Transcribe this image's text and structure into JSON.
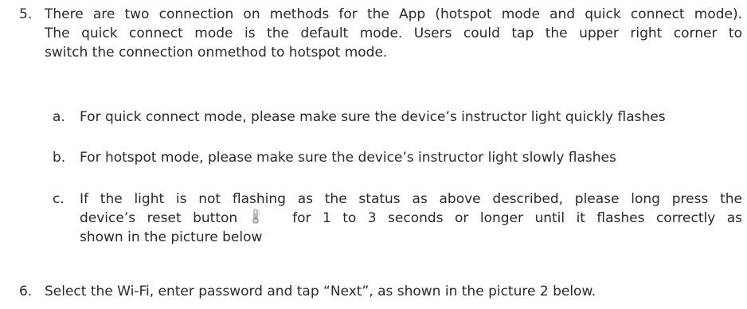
{
  "items": [
    {
      "number": "5.",
      "lines": [
        "There are two connection on methods for the App (hotspot mode and quick connect mode).",
        "The quick connect mode is the default mode. Users could tap the upper right corner to",
        "switch the connection onmethod to hotspot mode."
      ]
    },
    {
      "number": "a.",
      "lines": [
        "For quick connect mode, please make sure the device’s instructor light quickly flashes"
      ]
    },
    {
      "number": "b.",
      "lines": [
        "For hotspot mode, please make sure the device’s instructor light slowly flashes"
      ]
    },
    {
      "number": "c.",
      "line1": "If the light is not flashing as the status as above described, please long press the",
      "line2_before_icon": "device’s reset button",
      "icon": "thermometer-icon",
      "line2_after_icon": "for 1 to 3 seconds or longer until it flashes correctly as",
      "line3": "shown in the picture below"
    },
    {
      "number": "6.",
      "lines": [
        "Select the Wi-Fi, enter password and tap “Next”, as shown in the picture 2 below."
      ]
    }
  ]
}
